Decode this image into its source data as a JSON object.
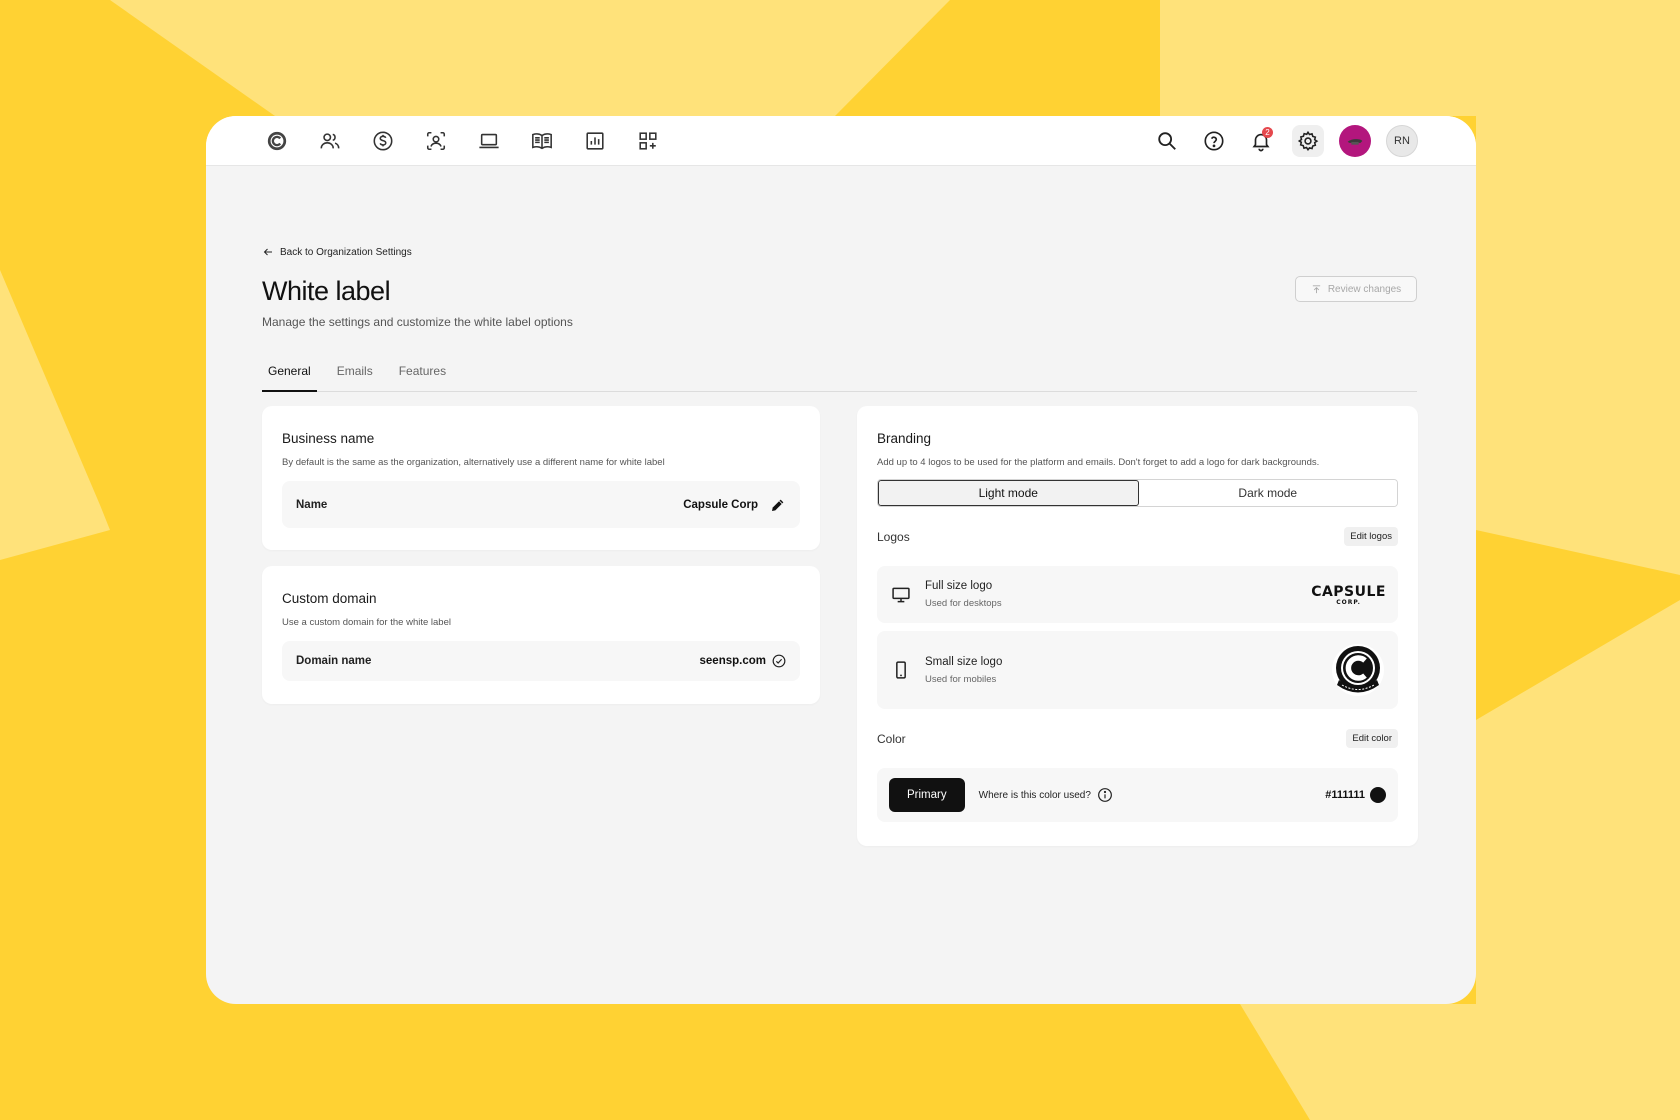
{
  "background": {
    "base": "#ffd233",
    "light": "#ffe27a"
  },
  "topbar": {
    "nav_icons": [
      "capsule-logo-icon",
      "users-icon",
      "dollar-icon",
      "contacts-icon",
      "laptop-icon",
      "book-icon",
      "chart-icon",
      "apps-add-icon"
    ],
    "right_icons": [
      "search-icon",
      "help-icon",
      "bell-icon",
      "gear-icon"
    ],
    "notification_count": "2",
    "user_initials": "RN",
    "brand_color": "#b3167d"
  },
  "header": {
    "back_label": "Back to Organization Settings",
    "title": "White label",
    "subtitle": "Manage the settings and customize the white label options",
    "review_button": "Review changes"
  },
  "tabs": [
    {
      "label": "General",
      "active": true
    },
    {
      "label": "Emails",
      "active": false
    },
    {
      "label": "Features",
      "active": false
    }
  ],
  "business": {
    "title": "Business name",
    "description": "By default is the same as the organization, alternatively use a different name for white label",
    "field_label": "Name",
    "field_value": "Capsule Corp"
  },
  "domain": {
    "title": "Custom domain",
    "description": "Use a custom domain for the white label",
    "field_label": "Domain name",
    "field_value": "seensp.com"
  },
  "branding": {
    "title": "Branding",
    "description": "Add up to 4 logos to be used for the platform and emails. Don't forget to add a logo for dark backgrounds.",
    "modes": [
      "Light mode",
      "Dark mode"
    ],
    "active_mode": "Light mode",
    "logos_label": "Logos",
    "edit_logos": "Edit logos",
    "full_logo": {
      "name": "Full size logo",
      "sub": "Used for desktops",
      "logo_text": "CAPSULE",
      "logo_sub": "CORP."
    },
    "small_logo": {
      "name": "Small size logo",
      "sub": "Used for mobiles"
    },
    "color_label": "Color",
    "edit_color": "Edit color",
    "primary_label": "Primary",
    "color_help": "Where is this color used?",
    "color_hex": "#111111"
  }
}
